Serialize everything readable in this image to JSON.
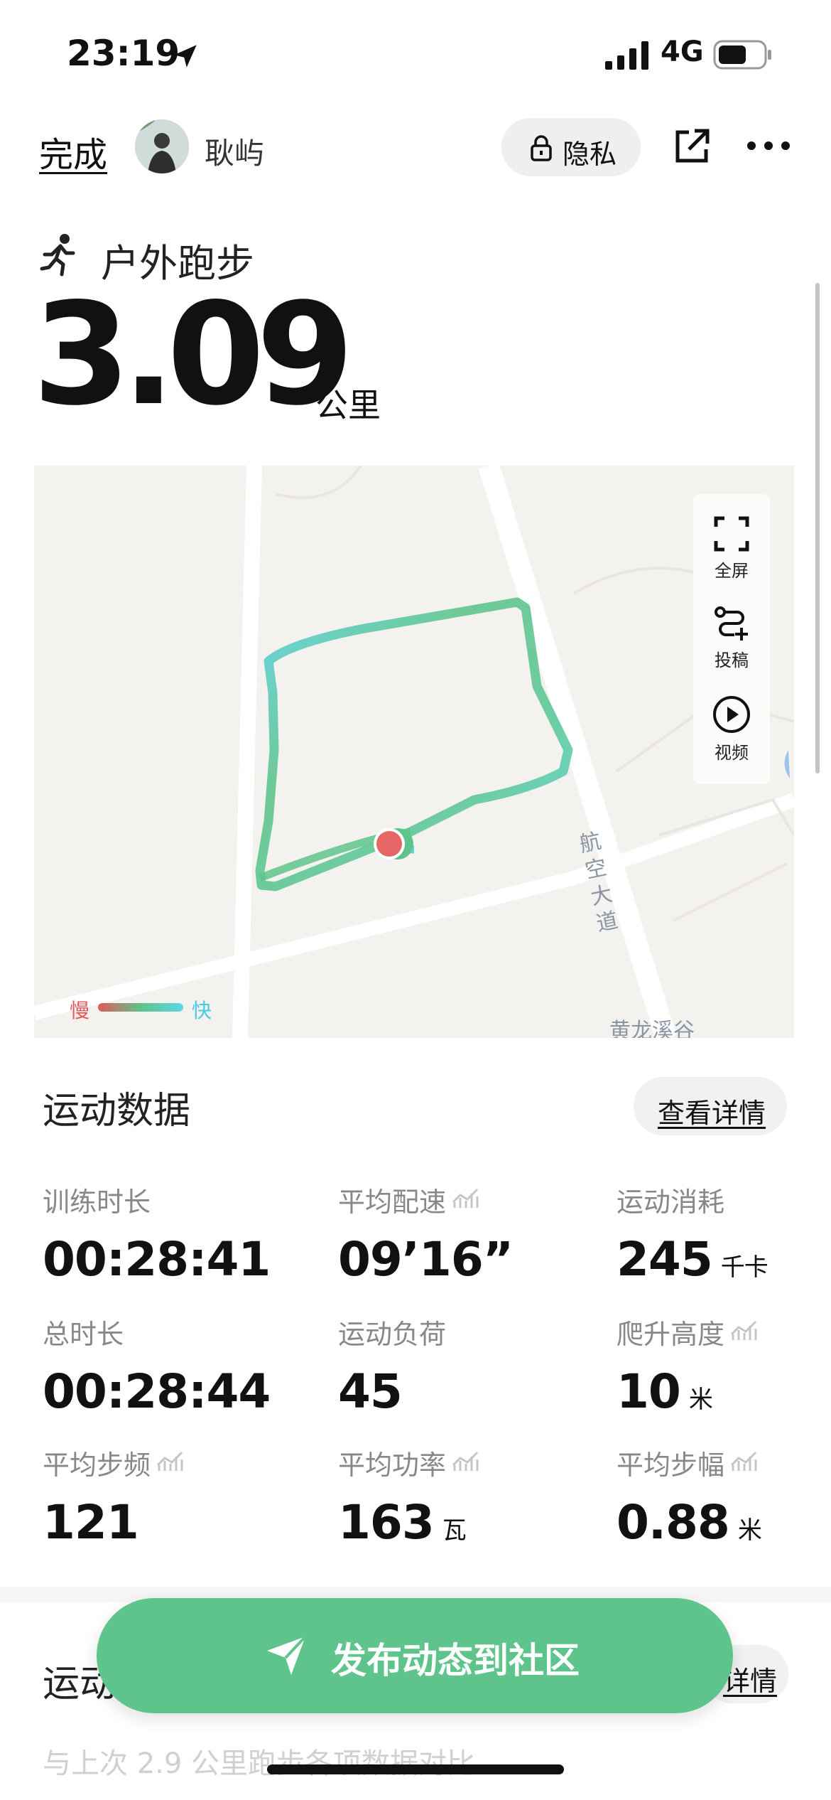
{
  "status_bar": {
    "time": "23:19",
    "network": "4G"
  },
  "header": {
    "done_label": "完成",
    "username": "耿屿",
    "privacy_label": "隐私"
  },
  "activity": {
    "type": "户外跑步",
    "distance": "3.09",
    "distance_unit": "公里"
  },
  "map": {
    "tools": [
      {
        "label": "全屏",
        "icon": "fullscreen-icon"
      },
      {
        "label": "投稿",
        "icon": "route-submit-icon"
      },
      {
        "label": "视频",
        "icon": "play-video-icon"
      }
    ],
    "road_labels": [
      "航空大道",
      "黄龙溪谷"
    ],
    "legend": {
      "slow": "慢",
      "fast": "快"
    },
    "colors": {
      "slow": "#e15a5a",
      "mid": "#5ec28a",
      "fast": "#5cd7ea"
    }
  },
  "stats": {
    "title": "运动数据",
    "details_label": "查看详情",
    "items": [
      {
        "label": "训练时长",
        "value": "00:28:41",
        "unit": "",
        "chart": false
      },
      {
        "label": "平均配速",
        "value": "09’16”",
        "unit": "",
        "chart": true
      },
      {
        "label": "运动消耗",
        "value": "245",
        "unit": "千卡",
        "chart": false
      },
      {
        "label": "总时长",
        "value": "00:28:44",
        "unit": "",
        "chart": false
      },
      {
        "label": "运动负荷",
        "value": "45",
        "unit": "",
        "chart": false
      },
      {
        "label": "爬升高度",
        "value": "10",
        "unit": "米",
        "chart": true
      },
      {
        "label": "平均步频",
        "value": "121",
        "unit": "",
        "chart": true
      },
      {
        "label": "平均功率",
        "value": "163",
        "unit": "瓦",
        "chart": true
      },
      {
        "label": "平均步幅",
        "value": "0.88",
        "unit": "米",
        "chart": true
      }
    ]
  },
  "section2": {
    "title": "运动",
    "details_label": "详情",
    "compare_text": "与上次 2.9 公里跑步各项数据对比"
  },
  "publish": {
    "label": "发布动态到社区"
  },
  "colors": {
    "accent_green": "#5fc48c"
  }
}
